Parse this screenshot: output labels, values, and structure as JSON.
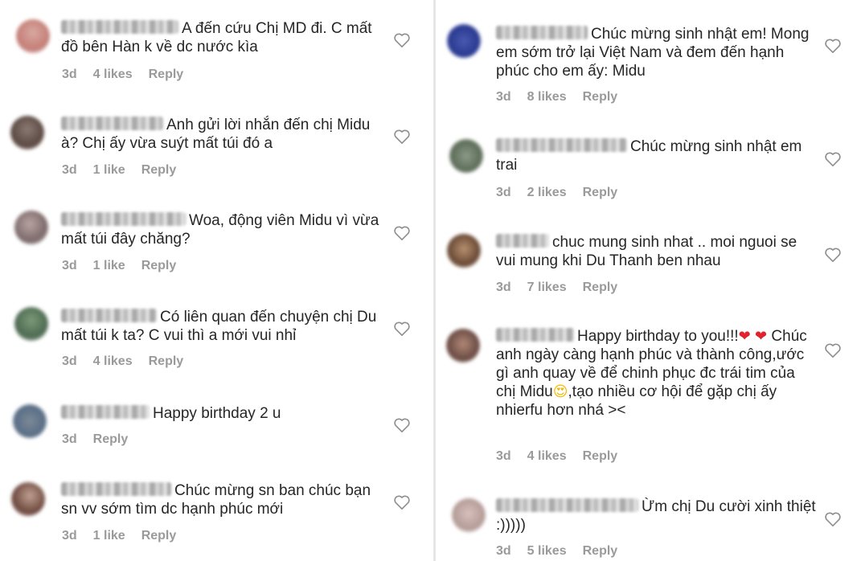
{
  "left_comments": [
    {
      "text": "A đến cứu Chị MD đi. C mất đồ bên Hàn k về dc nước kìa",
      "time": "3d",
      "likes": "4 likes",
      "reply": "Reply"
    },
    {
      "text": "Anh gửi lời nhắn đến chị Midu à? Chị ấy vừa suýt mất túi đó a",
      "time": "3d",
      "likes": "1 like",
      "reply": "Reply"
    },
    {
      "text": "Woa, động viên Midu vì vừa mất túi đây chăng?",
      "time": "3d",
      "likes": "1 like",
      "reply": "Reply"
    },
    {
      "text": "Có liên quan đến chuyện chị Du mất túi k ta? C vui thì a mới vui nhỉ",
      "time": "3d",
      "likes": "4 likes",
      "reply": "Reply"
    },
    {
      "text": "Happy birthday 2 u",
      "time": "3d",
      "likes": "",
      "reply": "Reply"
    },
    {
      "text": "Chúc mừng sn ban chúc bạn sn vv sớm tìm dc hạnh phúc mới",
      "time": "3d",
      "likes": "1 like",
      "reply": "Reply"
    }
  ],
  "right_comments": [
    {
      "text": "Chúc mừng sinh nhật em! Mong em sớm trở lại Việt Nam và đem đến hạnh phúc cho em ấy: Midu",
      "time": "3d",
      "likes": "8 likes",
      "reply": "Reply"
    },
    {
      "text": "Chúc mừng sinh nhật em trai",
      "time": "3d",
      "likes": "2 likes",
      "reply": "Reply"
    },
    {
      "text": "chuc mung sinh nhat .. moi nguoi se vui mung khi Du Thanh ben nhau",
      "time": "3d",
      "likes": "7 likes",
      "reply": "Reply"
    },
    {
      "text_parts": [
        "Happy birthday to you!!!",
        "Chúc anh ngày càng hạnh phúc và thành công,ước gì anh quay về để chinh phục đc trái tim của chị Midu",
        ",tạo nhiều cơ hội để gặp chị ấy nhierfu hơn nhá ><"
      ],
      "emoji_heart": "❤",
      "emoji_face": "😍",
      "time": "3d",
      "likes": "4 likes",
      "reply": "Reply"
    },
    {
      "text": "Ừm chị Du cười xinh thiệt :)))))",
      "time": "3d",
      "likes": "5 likes",
      "reply": "Reply"
    }
  ],
  "icons": {
    "heart": "heart-outline-icon"
  },
  "colors": {
    "meta": "#9a9a9a",
    "text": "#262626",
    "heart_emoji": "#e0232e"
  }
}
